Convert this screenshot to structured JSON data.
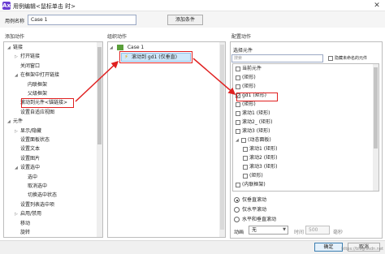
{
  "window": {
    "title": "用例编辑<鼠标单击 时>",
    "app_icon": "Ax",
    "close_glyph": "✕"
  },
  "case_row": {
    "label": "用例名称",
    "value": "Case 1",
    "add_condition": "添加条件"
  },
  "columns": {
    "add_action": "添加动作",
    "organize_action": "组织动作",
    "configure_action": "配置动作"
  },
  "actions_tree": [
    {
      "label": "链接",
      "expander": "◢",
      "indent": 0
    },
    {
      "label": "打开链接",
      "expander": "▷",
      "indent": 1
    },
    {
      "label": "关闭窗口",
      "expander": "",
      "indent": 1
    },
    {
      "label": "在框架中打开链接",
      "expander": "◢",
      "indent": 1
    },
    {
      "label": "内联框架",
      "expander": "",
      "indent": 2
    },
    {
      "label": "父级框架",
      "expander": "",
      "indent": 2
    },
    {
      "label": "滚动到元件<锚链接>",
      "expander": "",
      "indent": 1
    },
    {
      "label": "设置自适应视图",
      "expander": "",
      "indent": 1
    },
    {
      "label": "元件",
      "expander": "◢",
      "indent": 0
    },
    {
      "label": "显示/隐藏",
      "expander": "▷",
      "indent": 1
    },
    {
      "label": "设置面板状态",
      "expander": "",
      "indent": 1
    },
    {
      "label": "设置文本",
      "expander": "",
      "indent": 1
    },
    {
      "label": "设置图片",
      "expander": "",
      "indent": 1
    },
    {
      "label": "设置选中",
      "expander": "◢",
      "indent": 1
    },
    {
      "label": "选中",
      "expander": "",
      "indent": 2
    },
    {
      "label": "取消选中",
      "expander": "",
      "indent": 2
    },
    {
      "label": "切换选中状态",
      "expander": "",
      "indent": 2
    },
    {
      "label": "设置列表选中项",
      "expander": "",
      "indent": 1
    },
    {
      "label": "启用/禁用",
      "expander": "▷",
      "indent": 1
    },
    {
      "label": "移动",
      "expander": "",
      "indent": 1
    },
    {
      "label": "旋转",
      "expander": "",
      "indent": 1
    }
  ],
  "organize": {
    "case_expander": "◢",
    "case_name": "Case 1",
    "action_label": "滚动到 gd1 (仅垂直)"
  },
  "configure": {
    "select_widget_label": "选择元件",
    "search_placeholder": "搜索",
    "hide_unnamed_label": "隐藏未命名的元件",
    "widgets": [
      {
        "label": "当前元件",
        "checked": false,
        "expander": "",
        "indent": 0
      },
      {
        "label": "(矩形)",
        "checked": false,
        "expander": "",
        "indent": 0
      },
      {
        "label": "(矩形)",
        "checked": false,
        "expander": "",
        "indent": 0
      },
      {
        "label": "gd1 (矩形)",
        "checked": true,
        "expander": "",
        "indent": 0
      },
      {
        "label": "(矩形)",
        "checked": false,
        "expander": "",
        "indent": 0
      },
      {
        "label": "滚动1 (矩形)",
        "checked": false,
        "expander": "",
        "indent": 0
      },
      {
        "label": "滚动2_ (矩形)",
        "checked": false,
        "expander": "",
        "indent": 0
      },
      {
        "label": "滚动3 (矩形)",
        "checked": false,
        "expander": "",
        "indent": 0
      },
      {
        "label": "(动态面板)",
        "checked": false,
        "expander": "◢",
        "indent": 0
      },
      {
        "label": "滚动1 (矩形)",
        "checked": false,
        "expander": "",
        "indent": 1
      },
      {
        "label": "滚动2 (矩形)",
        "checked": false,
        "expander": "",
        "indent": 1
      },
      {
        "label": "滚动3 (矩形)",
        "checked": false,
        "expander": "",
        "indent": 1
      },
      {
        "label": "(矩形)",
        "checked": false,
        "expander": "",
        "indent": 1
      },
      {
        "label": "(内联框架)",
        "checked": false,
        "expander": "",
        "indent": 0
      }
    ],
    "scroll_options": [
      {
        "label": "仅垂直滚动",
        "selected": true
      },
      {
        "label": "仅水平滚动",
        "selected": false
      },
      {
        "label": "水平和垂直滚动",
        "selected": false
      }
    ],
    "animation_label": "动画",
    "animation_value": "无",
    "time_label": "时间",
    "time_value": "500",
    "time_unit": "毫秒"
  },
  "footer": {
    "ok": "确定",
    "cancel": "取消"
  },
  "watermark": "https://blog.csdn.net",
  "colors": {
    "annotation_red": "#e02020",
    "selected_blue": "#cfe8fb",
    "accent_purple": "#6b3fd3"
  }
}
